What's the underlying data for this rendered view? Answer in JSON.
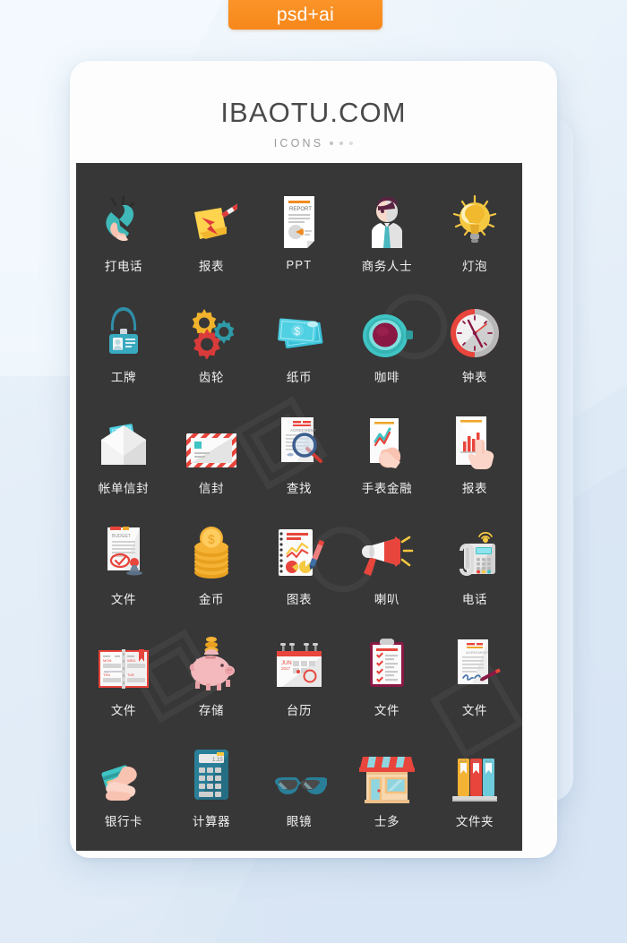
{
  "badge": {
    "label": "psd+ai",
    "color": "#f7871a"
  },
  "card": {
    "title": "IBAOTU.COM",
    "subtitle": "ICONS",
    "panel_color": "#373737",
    "card_color": "#fdfdfd"
  },
  "grid": {
    "columns": 5,
    "rows": 6,
    "items": [
      {
        "icon": "phone-call-icon",
        "label": "打电话",
        "latin": false
      },
      {
        "icon": "report-sticky-icon",
        "label": "报表",
        "latin": false
      },
      {
        "icon": "ppt-document-icon",
        "label": "PPT",
        "latin": true
      },
      {
        "icon": "businessman-icon",
        "label": "商务人士",
        "latin": false
      },
      {
        "icon": "lightbulb-icon",
        "label": "灯泡",
        "latin": false
      },
      {
        "icon": "id-badge-icon",
        "label": "工牌",
        "latin": false
      },
      {
        "icon": "gears-icon",
        "label": "齿轮",
        "latin": false
      },
      {
        "icon": "banknotes-icon",
        "label": "纸币",
        "latin": false
      },
      {
        "icon": "coffee-cup-icon",
        "label": "咖啡",
        "latin": false
      },
      {
        "icon": "clock-icon",
        "label": "钟表",
        "latin": false
      },
      {
        "icon": "bill-envelope-icon",
        "label": "帐单信封",
        "latin": false
      },
      {
        "icon": "envelope-icon",
        "label": "信封",
        "latin": false
      },
      {
        "icon": "search-document-icon",
        "label": "查找",
        "latin": false
      },
      {
        "icon": "hand-chart-icon",
        "label": "手表金融",
        "latin": false
      },
      {
        "icon": "touch-report-icon",
        "label": "报表",
        "latin": false
      },
      {
        "icon": "budget-document-icon",
        "label": "文件",
        "latin": false
      },
      {
        "icon": "gold-coins-icon",
        "label": "金币",
        "latin": false
      },
      {
        "icon": "chart-notebook-icon",
        "label": "图表",
        "latin": false
      },
      {
        "icon": "megaphone-icon",
        "label": "喇叭",
        "latin": false
      },
      {
        "icon": "desk-phone-icon",
        "label": "电话",
        "latin": false
      },
      {
        "icon": "planner-book-icon",
        "label": "文件",
        "latin": false
      },
      {
        "icon": "piggy-bank-icon",
        "label": "存储",
        "latin": false
      },
      {
        "icon": "desk-calendar-icon",
        "label": "台历",
        "latin": false
      },
      {
        "icon": "checklist-icon",
        "label": "文件",
        "latin": false
      },
      {
        "icon": "signed-document-icon",
        "label": "文件",
        "latin": false
      },
      {
        "icon": "credit-card-hand-icon",
        "label": "银行卡",
        "latin": false
      },
      {
        "icon": "calculator-icon",
        "label": "计算器",
        "latin": false
      },
      {
        "icon": "sunglasses-icon",
        "label": "眼镜",
        "latin": false
      },
      {
        "icon": "storefront-icon",
        "label": "士多",
        "latin": false
      },
      {
        "icon": "folders-icon",
        "label": "文件夹",
        "latin": false
      }
    ]
  }
}
